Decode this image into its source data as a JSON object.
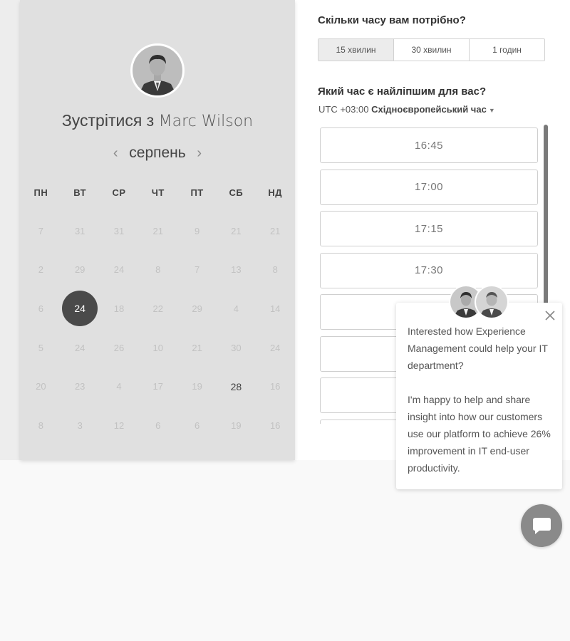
{
  "calendar": {
    "host_prefix": "Зустрітися з",
    "host_name": "Marc Wilson",
    "month": "серпень",
    "weekdays": [
      "ПН",
      "ВТ",
      "СР",
      "ЧТ",
      "ПТ",
      "СБ",
      "НД"
    ],
    "days": [
      {
        "label": "7",
        "state": "disabled"
      },
      {
        "label": "31",
        "state": "disabled"
      },
      {
        "label": "31",
        "state": "disabled"
      },
      {
        "label": "21",
        "state": "disabled"
      },
      {
        "label": "9",
        "state": "disabled"
      },
      {
        "label": "21",
        "state": "disabled"
      },
      {
        "label": "21",
        "state": "disabled"
      },
      {
        "label": "2",
        "state": "disabled"
      },
      {
        "label": "29",
        "state": "disabled"
      },
      {
        "label": "24",
        "state": "disabled"
      },
      {
        "label": "8",
        "state": "disabled"
      },
      {
        "label": "7",
        "state": "disabled"
      },
      {
        "label": "13",
        "state": "disabled"
      },
      {
        "label": "8",
        "state": "disabled"
      },
      {
        "label": "6",
        "state": "disabled"
      },
      {
        "label": "24",
        "state": "selected"
      },
      {
        "label": "18",
        "state": "disabled"
      },
      {
        "label": "22",
        "state": "disabled"
      },
      {
        "label": "29",
        "state": "disabled"
      },
      {
        "label": "4",
        "state": "disabled"
      },
      {
        "label": "14",
        "state": "disabled"
      },
      {
        "label": "5",
        "state": "disabled"
      },
      {
        "label": "24",
        "state": "disabled"
      },
      {
        "label": "26",
        "state": "disabled"
      },
      {
        "label": "10",
        "state": "disabled"
      },
      {
        "label": "21",
        "state": "disabled"
      },
      {
        "label": "30",
        "state": "disabled"
      },
      {
        "label": "24",
        "state": "disabled"
      },
      {
        "label": "20",
        "state": "disabled"
      },
      {
        "label": "23",
        "state": "disabled"
      },
      {
        "label": "4",
        "state": "disabled"
      },
      {
        "label": "17",
        "state": "disabled"
      },
      {
        "label": "19",
        "state": "disabled"
      },
      {
        "label": "28",
        "state": "available"
      },
      {
        "label": "16",
        "state": "disabled"
      },
      {
        "label": "8",
        "state": "disabled"
      },
      {
        "label": "3",
        "state": "disabled"
      },
      {
        "label": "12",
        "state": "disabled"
      },
      {
        "label": "6",
        "state": "disabled"
      },
      {
        "label": "6",
        "state": "disabled"
      },
      {
        "label": "19",
        "state": "disabled"
      },
      {
        "label": "16",
        "state": "disabled"
      }
    ]
  },
  "booking": {
    "duration_question": "Скільки часу вам потрібно?",
    "durations": [
      "15 хвилин",
      "30 хвилин",
      "1 годин"
    ],
    "time_question": "Який час є найліпшим для вас?",
    "timezone_prefix": "UTC +03:00",
    "timezone_name": "Східноєвропейський час",
    "slots": [
      "16:45",
      "17:00",
      "17:15",
      "17:30",
      "",
      "",
      "",
      ""
    ]
  },
  "chat": {
    "message": "Interested how Experience Management could help your IT department?\n\nI'm happy to help and share insight into how our customers use our platform to achieve 26% improvement in IT end-user productivity."
  },
  "icons": {
    "close": "close-icon",
    "chat": "chat-bubble-icon",
    "prev": "chevron-left-icon",
    "next": "chevron-right-icon",
    "caret": "caret-down-icon"
  },
  "colors": {
    "selected_day": "#4a4a4a",
    "panel_bg": "#e0e0e0",
    "chat_button": "#8a8a8a"
  }
}
